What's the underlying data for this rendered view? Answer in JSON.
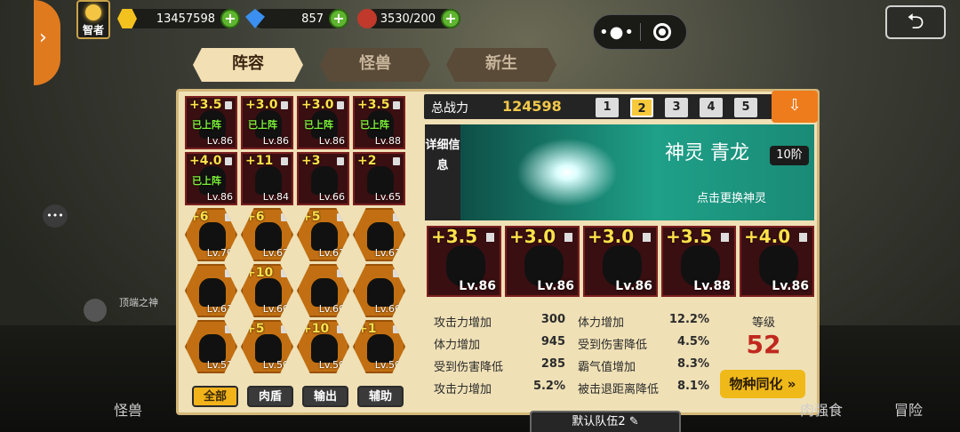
{
  "top": {
    "sage_label": "智者",
    "gold": "13457598",
    "gems": "857",
    "stamina": "3530/200",
    "plus": "+",
    "back_icon": "return-arrow-icon"
  },
  "tabs": [
    {
      "label": "阵容",
      "active": true
    },
    {
      "label": "怪兽",
      "active": false
    },
    {
      "label": "新生",
      "active": false
    }
  ],
  "roster": [
    {
      "star": "+3.5",
      "lv": "Lv.86",
      "deployed": "已上阵",
      "kind": "red"
    },
    {
      "star": "+3.0",
      "lv": "Lv.86",
      "deployed": "已上阵",
      "kind": "red"
    },
    {
      "star": "+3.0",
      "lv": "Lv.86",
      "deployed": "已上阵",
      "kind": "red"
    },
    {
      "star": "+3.5",
      "lv": "Lv.88",
      "deployed": "已上阵",
      "kind": "red"
    },
    {
      "star": "+4.0",
      "lv": "Lv.86",
      "deployed": "已上阵",
      "kind": "red"
    },
    {
      "star": "+11",
      "lv": "Lv.84",
      "deployed": "",
      "kind": "red"
    },
    {
      "star": "+3",
      "lv": "Lv.66",
      "deployed": "",
      "kind": "red"
    },
    {
      "star": "+2",
      "lv": "Lv.65",
      "deployed": "",
      "kind": "red"
    },
    {
      "star": "+6",
      "lv": "Lv.70",
      "deployed": "",
      "kind": "gold"
    },
    {
      "star": "+6",
      "lv": "Lv.62",
      "deployed": "",
      "kind": "gold"
    },
    {
      "star": "+5",
      "lv": "Lv.61",
      "deployed": "",
      "kind": "gold"
    },
    {
      "star": "",
      "lv": "Lv.61",
      "deployed": "",
      "kind": "gold"
    },
    {
      "star": "",
      "lv": "Lv.61",
      "deployed": "",
      "kind": "gold"
    },
    {
      "star": "+10",
      "lv": "Lv.60",
      "deployed": "",
      "kind": "gold"
    },
    {
      "star": "",
      "lv": "Lv.60",
      "deployed": "",
      "kind": "gold"
    },
    {
      "star": "",
      "lv": "Lv.60",
      "deployed": "",
      "kind": "gold"
    },
    {
      "star": "",
      "lv": "Lv.51",
      "deployed": "",
      "kind": "gold"
    },
    {
      "star": "+5",
      "lv": "Lv.50",
      "deployed": "",
      "kind": "gold"
    },
    {
      "star": "+10",
      "lv": "Lv.50",
      "deployed": "",
      "kind": "gold"
    },
    {
      "star": "+1",
      "lv": "Lv.50",
      "deployed": "",
      "kind": "gold"
    }
  ],
  "filters": [
    {
      "label": "全部",
      "active": true
    },
    {
      "label": "肉盾",
      "active": false
    },
    {
      "label": "输出",
      "active": false
    },
    {
      "label": "辅助",
      "active": false
    }
  ],
  "header": {
    "label": "总战力",
    "power": "124598",
    "teams": [
      "1",
      "2",
      "3",
      "4",
      "5"
    ],
    "active_team": "2"
  },
  "detail": {
    "label": "详细信息",
    "spirit_prefix": "神灵",
    "spirit_name": "青龙",
    "tier": "10阶",
    "change": "点击更换神灵"
  },
  "team_monsters": [
    {
      "star": "+3.5",
      "lv": "Lv.86"
    },
    {
      "star": "+3.0",
      "lv": "Lv.86"
    },
    {
      "star": "+3.0",
      "lv": "Lv.86"
    },
    {
      "star": "+3.5",
      "lv": "Lv.88"
    },
    {
      "star": "+4.0",
      "lv": "Lv.86"
    }
  ],
  "stats": [
    {
      "k": "攻击力增加",
      "v": "300"
    },
    {
      "k": "体力增加",
      "v": "12.2%"
    },
    {
      "k": "体力增加",
      "v": "945"
    },
    {
      "k": "受到伤害降低",
      "v": "4.5%"
    },
    {
      "k": "受到伤害降低",
      "v": "285"
    },
    {
      "k": "霸气值增加",
      "v": "8.3%"
    },
    {
      "k": "攻击力增加",
      "v": "5.2%"
    },
    {
      "k": "被击退距离降低",
      "v": "8.1%"
    }
  ],
  "level": {
    "label": "等级",
    "value": "52"
  },
  "sync_button": "物种同化",
  "team_name": "默认队伍2",
  "side": {
    "label": "顶端之神"
  },
  "bottom_nav": [
    "怪兽",
    "肉强食",
    "冒险"
  ]
}
